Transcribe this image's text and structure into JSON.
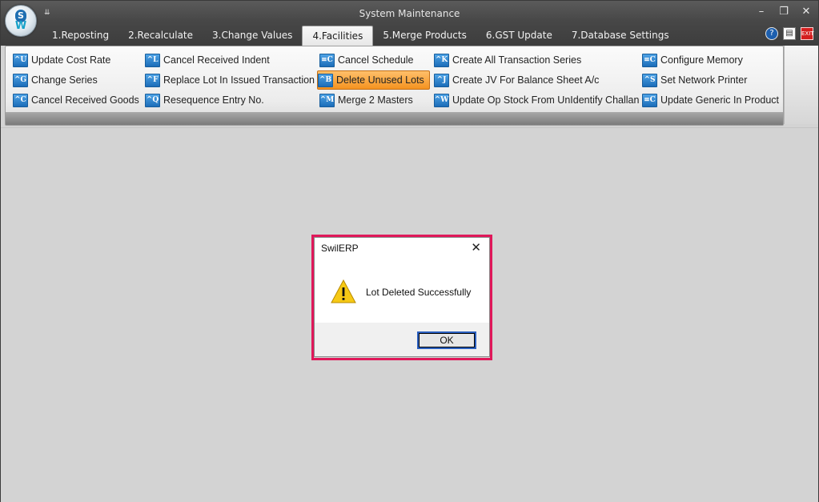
{
  "window": {
    "title": "System Maintenance",
    "controls": {
      "minimize": "–",
      "maximize": "❐",
      "close": "✕"
    },
    "quick_access": "⇊"
  },
  "logo": {
    "badge": "S",
    "mark": "W"
  },
  "tabs": [
    {
      "label": "1.Reposting",
      "active": false
    },
    {
      "label": "2.Recalculate",
      "active": false
    },
    {
      "label": "3.Change Values",
      "active": false
    },
    {
      "label": "4.Facilities",
      "active": true
    },
    {
      "label": "5.Merge Products",
      "active": false
    },
    {
      "label": "6.GST Update",
      "active": false
    },
    {
      "label": "7.Database Settings",
      "active": false
    }
  ],
  "right_icons": {
    "help": "?",
    "doc": "▤",
    "exit": "EXIT"
  },
  "ribbon": {
    "col1": [
      {
        "label": "Update Cost Rate",
        "icon": "^U"
      },
      {
        "label": "Change Series",
        "icon": "^G"
      },
      {
        "label": "Cancel Received Goods",
        "icon": "^C"
      }
    ],
    "col2": [
      {
        "label": "Cancel Received Indent",
        "icon": "^L"
      },
      {
        "label": "Replace Lot In Issued Transaction",
        "icon": "^F"
      },
      {
        "label": "Resequence Entry No.",
        "icon": "^Q"
      }
    ],
    "col3": [
      {
        "label": "Cancel Schedule",
        "icon": "≡C"
      },
      {
        "label": "Delete Unused Lots",
        "icon": "^B",
        "selected": true
      },
      {
        "label": "Merge 2 Masters",
        "icon": "^M"
      }
    ],
    "col4": [
      {
        "label": "Create All Transaction Series",
        "icon": "^K"
      },
      {
        "label": "Create JV For Balance Sheet A/c",
        "icon": "^J"
      },
      {
        "label": "Update Op Stock From UnIdentify Challan",
        "icon": "^W"
      }
    ],
    "col5": [
      {
        "label": "Configure Memory",
        "icon": "≡C"
      },
      {
        "label": "Set Network Printer",
        "icon": "^S"
      },
      {
        "label": "Update Generic In Product",
        "icon": "≡C"
      }
    ]
  },
  "dialog": {
    "title": "SwilERP",
    "message": "Lot Deleted Successfully",
    "ok_label": "OK",
    "close": "✕"
  },
  "colors": {
    "highlight_border": "#e0185a",
    "selected_button": "#f59320",
    "titlebar": "#474747"
  }
}
